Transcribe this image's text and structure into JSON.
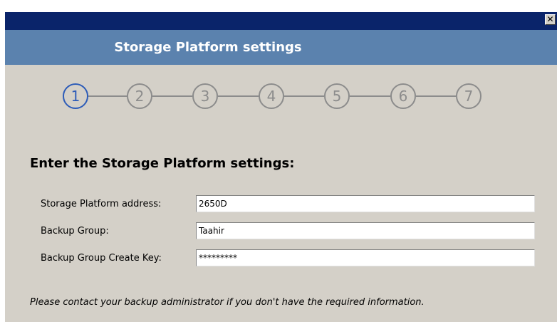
{
  "window": {
    "close_glyph": "✕"
  },
  "banner": {
    "title": "Storage Platform settings"
  },
  "steps": [
    "1",
    "2",
    "3",
    "4",
    "5",
    "6",
    "7"
  ],
  "active_step": "1",
  "form": {
    "heading": "Enter the Storage Platform settings:",
    "address_label": "Storage Platform address:",
    "address_value": "2650D",
    "group_label": "Backup Group:",
    "group_value": "Taahir",
    "key_label": "Backup Group Create Key:",
    "key_value": "*********"
  },
  "note": "Please contact your backup administrator if you don't have the required information.",
  "colors": {
    "titlebar": "#0a246a",
    "banner": "#5b82ae",
    "active_step": "#2d5cb8",
    "inactive_step": "#8c8c8c",
    "window_bg": "#d4d0c8"
  }
}
